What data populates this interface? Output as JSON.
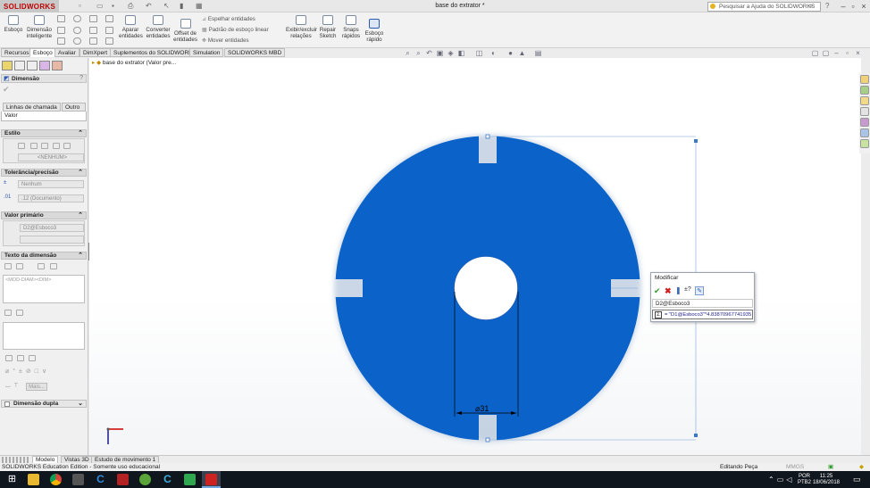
{
  "app": {
    "logo": "SOLIDWORKS",
    "document_title": "base do extrator *",
    "help_search_placeholder": "Pesquisar a Ajuda do SOLIDWORKS"
  },
  "ribbon": {
    "esboco": "Esboço",
    "dimensao_inteligente_1": "Dimensão",
    "dimensao_inteligente_2": "inteligente",
    "aparar_1": "Aparar",
    "aparar_2": "entidades",
    "converter_1": "Converter",
    "converter_2": "entidades",
    "offset_1": "Offset de",
    "offset_2": "entidades",
    "espelhar": "Espelhar entidades",
    "padrao": "Padrão de esboço linear",
    "mover": "Mover entidades",
    "exibir_1": "Exibir/excluir",
    "exibir_2": "relações",
    "repair_1": "Repair",
    "repair_2": "Sketch",
    "snaps_1": "Snaps",
    "snaps_2": "rápidos",
    "esboco_rapido_1": "Esboço",
    "esboco_rapido_2": "rápido"
  },
  "tabs": [
    "Recursos",
    "Esboço",
    "Avaliar",
    "DimXpert",
    "Suplementos do SOLIDWORKS",
    "Simulation",
    "SOLIDWORKS MBD"
  ],
  "active_tab": "Esboço",
  "tree": {
    "item": "base do extrator  (Valor pre..."
  },
  "property_manager": {
    "title": "Dimensão",
    "help": "?",
    "subtabs": [
      "Linhas de chamada",
      "Outro"
    ],
    "value_tab": "Valor",
    "estilo": "Estilo",
    "estilo_field": "<NENHUM>",
    "tolerancia": "Tolerância/precisão",
    "tol_field": "Nenhum",
    "precision_field": ".12 (Documento)",
    "valor_primario": "Valor primário",
    "primary_name": "D2@Esboco3",
    "texto_dimensao": "Texto da dimensão",
    "dim_text": "<MOD-DIAM><DIM>",
    "mais": "Mais...",
    "dimensao_dupla": "Dimensão dupla"
  },
  "drawing": {
    "dimension_label": "⌀31",
    "colors": {
      "part": "#0b63c9",
      "sketch": "#3a78c8",
      "dim": "#000000"
    }
  },
  "modify_dialog": {
    "title": "Modificar",
    "dim_name": "D2@Esboco3",
    "value": "= \"D1@Esboco3\"*4.83870967741935"
  },
  "bottom_tabs": [
    "Modelo",
    "Vistas 3D",
    "Estudo de movimento 1"
  ],
  "status": {
    "left": "SOLIDWORKS Education Edition - Somente uso educacional",
    "editing": "Editando Peça",
    "units": "MMGS"
  },
  "taskbar": {
    "lang_1": "POR",
    "lang_2": "PTB2",
    "time": "11:25",
    "date": "18/06/2018"
  }
}
